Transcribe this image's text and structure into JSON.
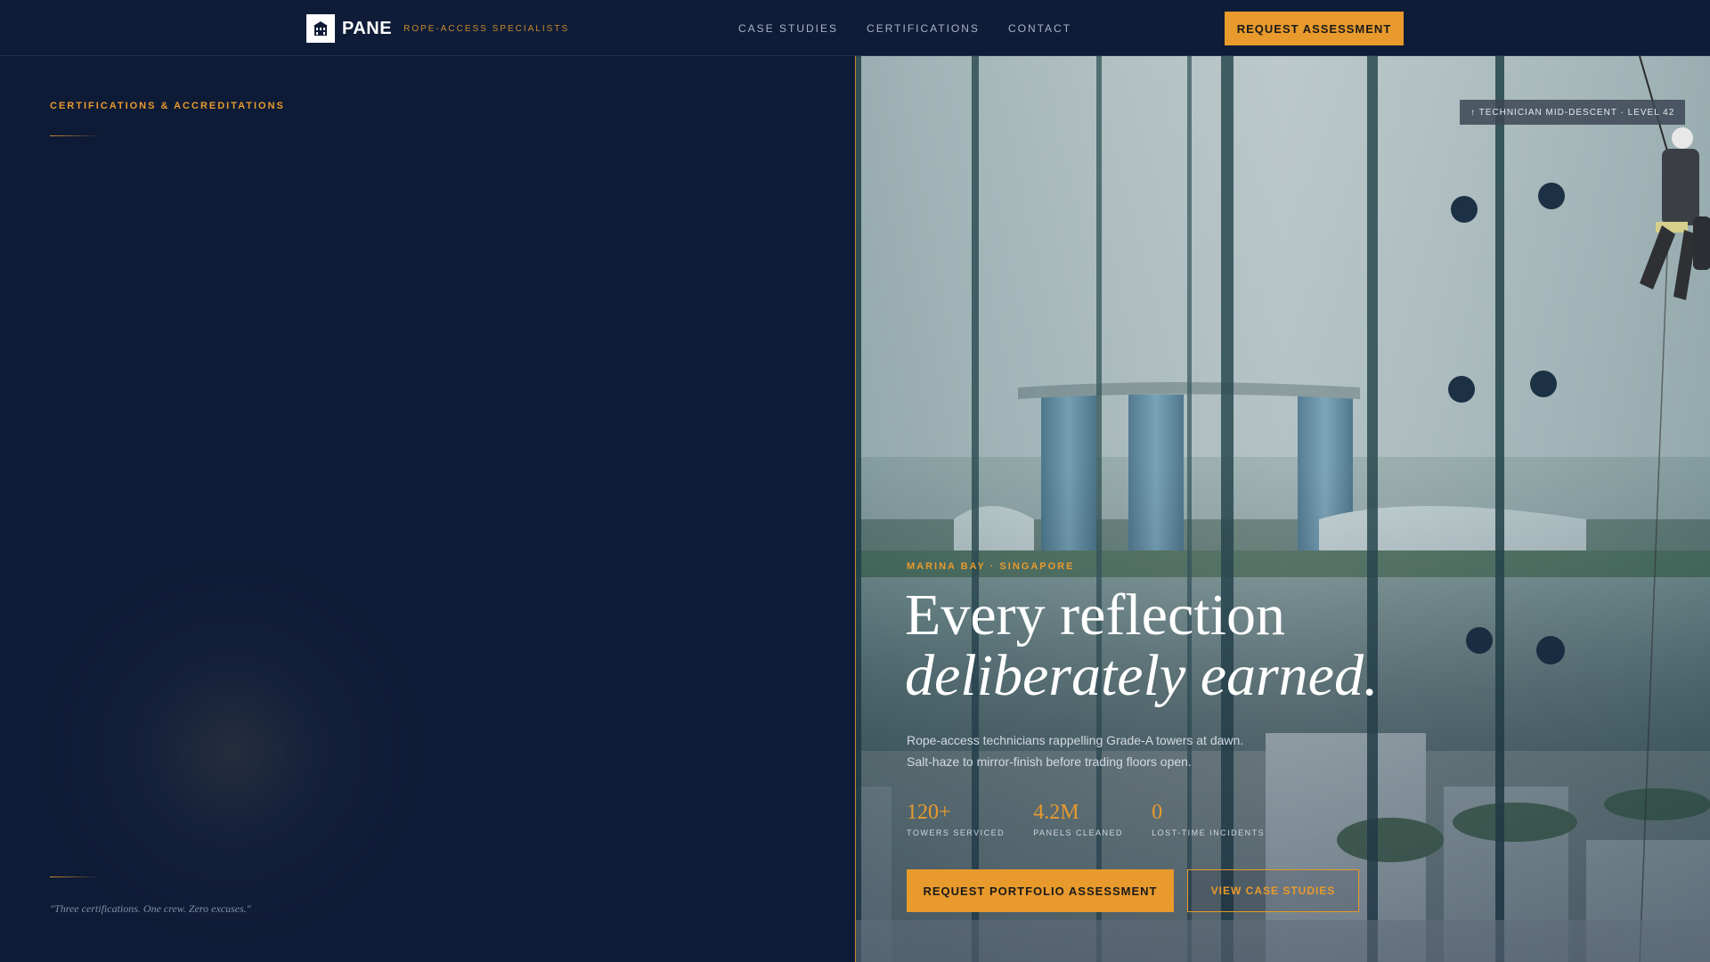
{
  "brand": {
    "name": "PANE",
    "tagline": "ROPE-ACCESS SPECIALISTS"
  },
  "nav": {
    "items": [
      {
        "label": "CASE STUDIES"
      },
      {
        "label": "CERTIFICATIONS"
      },
      {
        "label": "CONTACT"
      }
    ],
    "cta": "REQUEST ASSESSMENT"
  },
  "left_panel": {
    "section_label": "CERTIFICATIONS & ACCREDITATIONS",
    "quote": "\"Three certifications. One crew. Zero excuses.\""
  },
  "hero": {
    "badge": "↑ TECHNICIAN MID-DESCENT · LEVEL 42",
    "location": "MARINA BAY · SINGAPORE",
    "headline_line1": "Every reflection",
    "headline_line2": "deliberately earned.",
    "subtext": "Rope-access technicians rappelling Grade-A towers at dawn. Salt-haze to mirror-finish before trading floors open.",
    "stats": [
      {
        "value": "120+",
        "label": "TOWERS SERVICED"
      },
      {
        "value": "4.2M",
        "label": "PANELS CLEANED"
      },
      {
        "value": "0",
        "label": "LOST-TIME INCIDENTS"
      }
    ],
    "primary_button": "REQUEST PORTFOLIO ASSESSMENT",
    "secondary_button": "VIEW CASE STUDIES"
  },
  "colors": {
    "navy": "#0e1b36",
    "accent": "#e89a2c"
  }
}
